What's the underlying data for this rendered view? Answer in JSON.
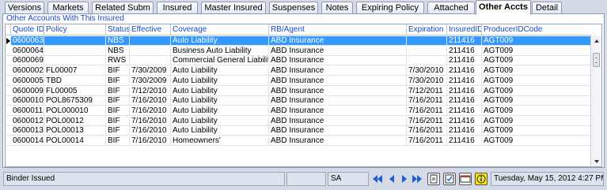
{
  "tabs": [
    {
      "label": "Versions",
      "active": false
    },
    {
      "label": "Markets",
      "active": false
    },
    {
      "label": "Related Subm",
      "active": false
    },
    {
      "label": "Insured",
      "active": false
    },
    {
      "label": "Master Insured",
      "active": false
    },
    {
      "label": "Suspenses",
      "active": false
    },
    {
      "label": "Notes",
      "active": false
    },
    {
      "label": "Expiring Policy",
      "active": false
    },
    {
      "label": "Attached Files",
      "active": false
    },
    {
      "label": "Other Accts",
      "active": true
    },
    {
      "label": "Detail",
      "active": false
    }
  ],
  "panel": {
    "title": "Other Accounts With This Insured"
  },
  "grid": {
    "columns": [
      "Quote ID",
      "Policy",
      "Status",
      "Effective",
      "Coverage",
      "RB/Agent",
      "Expiration",
      "InsuredID",
      "ProducerIDCode"
    ],
    "rows": [
      [
        "0600063",
        "",
        "NBS",
        "",
        "Auto Liability",
        "ABD Insurance",
        "",
        "211416",
        "AGT009"
      ],
      [
        "0600064",
        "",
        "NBS",
        "",
        "Business Auto Liability",
        "ABD Insurance",
        "",
        "211416",
        "AGT009"
      ],
      [
        "0600069",
        "",
        "RWS",
        "",
        "Commercial General Liability",
        "ABD Insurance",
        "",
        "211416",
        "AGT009"
      ],
      [
        "0600002",
        "FL00007",
        "BIF",
        "7/30/2009",
        "Auto Liability",
        "ABD Insurance",
        "7/30/2010",
        "211416",
        "AGT009"
      ],
      [
        "0600005",
        "TBD",
        "BIF",
        "7/30/2009",
        "Auto Liability",
        "ABD Insurance",
        "7/30/2010",
        "211416",
        "AGT009"
      ],
      [
        "0600009",
        "FL00005",
        "BIF",
        "7/12/2010",
        "Auto Liability",
        "ABD Insurance",
        "7/12/2011",
        "211416",
        "AGT009"
      ],
      [
        "0600010",
        "POL8675309",
        "BIF",
        "7/16/2010",
        "Auto Liability",
        "ABD Insurance",
        "7/16/2011",
        "211416",
        "AGT009"
      ],
      [
        "0600011",
        "POL000010",
        "BIF",
        "7/16/2010",
        "Auto Liability",
        "ABD Insurance",
        "7/16/2011",
        "211416",
        "AGT009"
      ],
      [
        "0600012",
        "POL00012",
        "BIF",
        "7/16/2010",
        "Auto Liability",
        "ABD Insurance",
        "7/16/2011",
        "211416",
        "AGT009"
      ],
      [
        "0600013",
        "POL00013",
        "BIF",
        "7/16/2010",
        "Auto Liability",
        "ABD Insurance",
        "7/16/2011",
        "211416",
        "AGT009"
      ],
      [
        "0600014",
        "POL00014",
        "BIF",
        "7/16/2010",
        "Homeowners'",
        "ABD Insurance",
        "7/16/2011",
        "211416",
        "AGT009"
      ]
    ],
    "selected_row": 0
  },
  "statusbar": {
    "message": "Binder Issued",
    "user": "SA",
    "datetime": "Tuesday, May 15, 2012 4:27 PM"
  },
  "icons": {
    "nav": [
      "first-record-icon",
      "previous-record-icon",
      "next-record-icon",
      "last-record-icon"
    ],
    "tools": [
      "clipboard-icon",
      "checklist-icon",
      "dialog-icon",
      "info-icon"
    ]
  },
  "colors": {
    "selection": "#3399ff",
    "header_text": "#1a49c4",
    "nav_arrow": "#1e5fd0",
    "info_bg": "#ffe600"
  }
}
